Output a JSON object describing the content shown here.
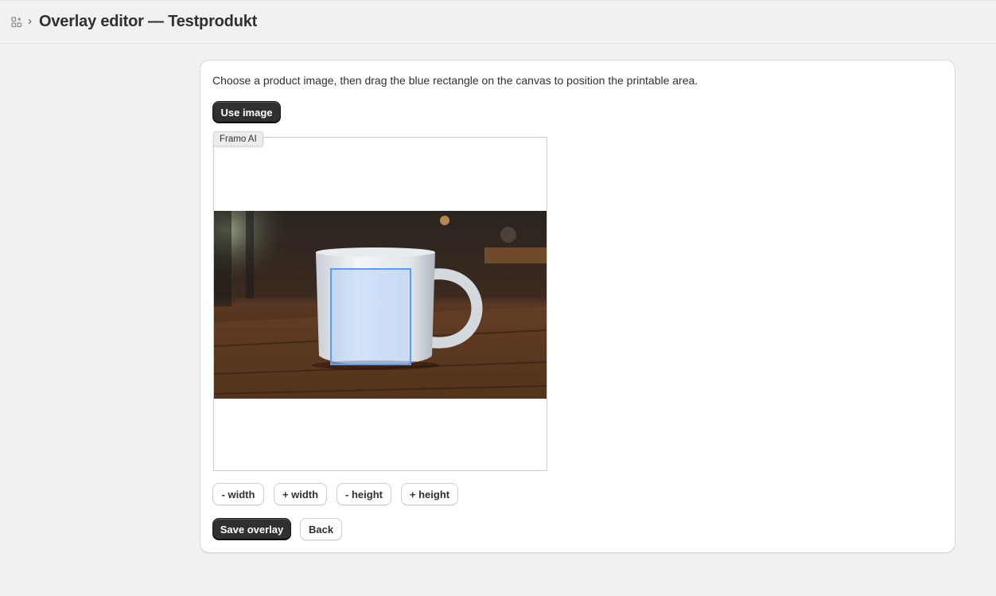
{
  "header": {
    "title": "Overlay editor — Testprodukt",
    "breadcrumb_icon": "apps-icon",
    "separator": "›"
  },
  "card": {
    "instructions": "Choose a product image, then drag the blue rectangle on the canvas to position the printable area.",
    "use_image_label": "Use image",
    "image_tag": "Framo AI",
    "controls": {
      "minus_width": "- width",
      "plus_width": "+ width",
      "minus_height": "- height",
      "plus_height": "+ height"
    },
    "save_label": "Save overlay",
    "back_label": "Back"
  },
  "colors": {
    "overlay_border": "#5b9cf5",
    "primary_button": "#303030",
    "page_background": "#f1f1f1"
  }
}
